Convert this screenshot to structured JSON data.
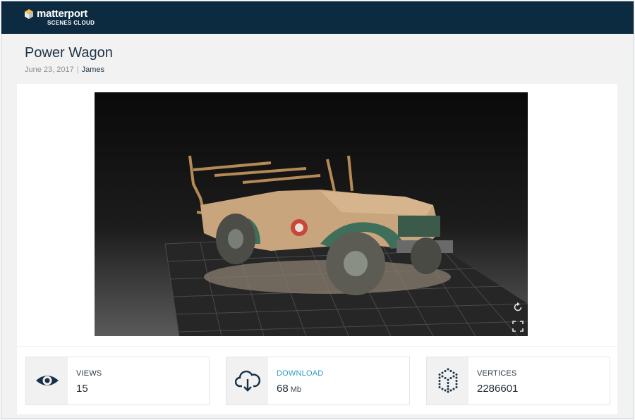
{
  "header": {
    "brand_name": "matterport",
    "brand_sub": "SCENES CLOUD",
    "background_color": "#0c2a40"
  },
  "scene": {
    "title": "Power Wagon",
    "date": "June 23, 2017",
    "separator": "|",
    "author": "James"
  },
  "viewer": {
    "controls": [
      "reset-view-icon",
      "fullscreen-icon"
    ]
  },
  "stats": {
    "views": {
      "label": "VIEWS",
      "value": "15",
      "icon": "eye-icon"
    },
    "download": {
      "label": "DOWNLOAD",
      "value": "68",
      "unit": "Mb",
      "icon": "cloud-download-icon",
      "color": "#2b9ac6"
    },
    "vertices": {
      "label": "VERTICES",
      "value": "2286601",
      "icon": "dotted-cube-icon"
    }
  }
}
